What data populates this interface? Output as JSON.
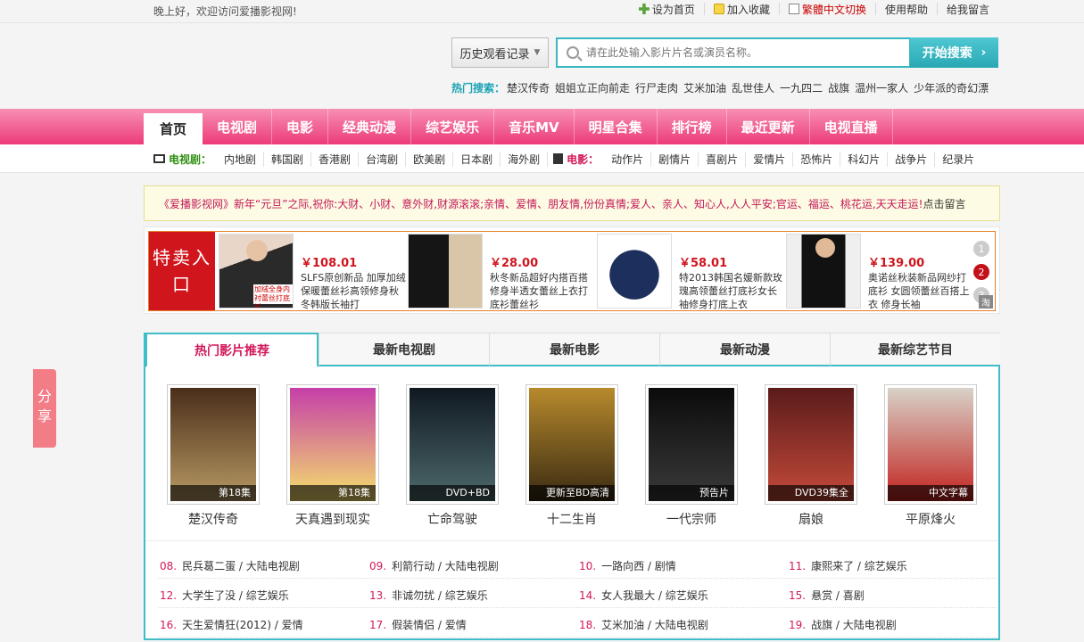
{
  "topbar": {
    "greeting": "晚上好，欢迎访问爱播影视网!",
    "links": [
      "设为首页",
      "加入收藏",
      "繁體中文切换",
      "使用帮助",
      "给我留言"
    ]
  },
  "header": {
    "history_label": "历史观看记录",
    "search_placeholder": "请在此处输入影片片名或演员名称。",
    "search_button": "开始搜索",
    "hot_label": "热门搜索：",
    "hot_terms": [
      "楚汉传奇",
      "姐姐立正向前走",
      "行尸走肉",
      "艾米加油",
      "乱世佳人",
      "一九四二",
      "战旗",
      "温州一家人",
      "少年派的奇幻漂"
    ]
  },
  "nav": [
    "首页",
    "电视剧",
    "电影",
    "经典动漫",
    "综艺娱乐",
    "音乐MV",
    "明星合集",
    "排行榜",
    "最近更新",
    "电视直播"
  ],
  "subnav": {
    "tv_label": "电视剧：",
    "tv": [
      "内地剧",
      "韩国剧",
      "香港剧",
      "台湾剧",
      "欧美剧",
      "日本剧",
      "海外剧"
    ],
    "film_label": "电影：",
    "film": [
      "动作片",
      "剧情片",
      "喜剧片",
      "爱情片",
      "恐怖片",
      "科幻片",
      "战争片",
      "纪录片"
    ]
  },
  "notice": {
    "text": "《爱播影视网》新年“元旦”之际,祝你:大财、小财、意外财,财源滚滚;亲情、爱情、朋友情,份份真情;爱人、亲人、知心人,人人平安;官运、福运、桃花运,天天走运!",
    "tail": "点击留言"
  },
  "sale": {
    "entry": "特卖入口",
    "products": [
      {
        "price": "￥108.01",
        "desc": "SLFS原创新品 加厚加绒保暖蕾丝衫高领修身秋冬韩版长袖打",
        "tag": "加绒全身内衬蕾丝打底衫",
        "colors": [
          "#2a2a2a",
          "#e8d7c9"
        ]
      },
      {
        "price": "￥28.00",
        "desc": "秋冬新品超好内搭百搭修身半透女蕾丝上衣打底衫蕾丝衫",
        "colors": [
          "#151515",
          "#d9c6a8"
        ]
      },
      {
        "price": "￥58.01",
        "desc": "特2013韩国名媛新款玫瑰高领蕾丝打底衫女长袖修身打底上衣",
        "colors": [
          "#1d2f5c",
          "#ffffff"
        ]
      },
      {
        "price": "￥139.00",
        "desc": "奥诺丝秋装新品网纱打底衫 女圆领蕾丝百搭上衣 修身长袖",
        "colors": [
          "#111111",
          "#efefef"
        ]
      }
    ],
    "dots": [
      "1",
      "2",
      "3"
    ],
    "tao": "淘"
  },
  "share": "分享",
  "tabs": [
    "热门影片推荐",
    "最新电视剧",
    "最新电影",
    "最新动漫",
    "最新综艺节目"
  ],
  "movies": [
    {
      "name": "楚汉传奇",
      "badge": "第18集",
      "c1": "#4a2e1a",
      "c2": "#b89a63"
    },
    {
      "name": "天真遇到现实",
      "badge": "第18集",
      "c1": "#c53fa8",
      "c2": "#f5e06c"
    },
    {
      "name": "亡命驾驶",
      "badge": "DVD+BD",
      "c1": "#101820",
      "c2": "#4d6a6d"
    },
    {
      "name": "十二生肖",
      "badge": "更新至BD高清",
      "c1": "#3a2a12",
      "c2": "#b78a2c"
    },
    {
      "name": "一代宗师",
      "badge": "预告片",
      "c1": "#0b0b0b",
      "c2": "#3a3a3a"
    },
    {
      "name": "扇娘",
      "badge": "DVD39集全",
      "c1": "#5b1b1b",
      "c2": "#c44a3a"
    },
    {
      "name": "平原烽火",
      "badge": "中文字幕",
      "c1": "#d8d2c8",
      "c2": "#c2231f"
    }
  ],
  "list": [
    [
      {
        "no": "08.",
        "t": "民兵葛二蛋 / 大陆电视剧"
      },
      {
        "no": "09.",
        "t": "利箭行动 / 大陆电视剧"
      },
      {
        "no": "10.",
        "t": "一路向西 / 剧情"
      },
      {
        "no": "11.",
        "t": "康熙来了 / 综艺娱乐"
      }
    ],
    [
      {
        "no": "12.",
        "t": "大学生了没 / 综艺娱乐"
      },
      {
        "no": "13.",
        "t": "非诚勿扰 / 综艺娱乐"
      },
      {
        "no": "14.",
        "t": "女人我最大 / 综艺娱乐"
      },
      {
        "no": "15.",
        "t": "悬赏 / 喜剧"
      }
    ],
    [
      {
        "no": "16.",
        "t": "天生爱情狂(2012) / 爱情"
      },
      {
        "no": "17.",
        "t": "假装情侣 / 爱情"
      },
      {
        "no": "18.",
        "t": "艾米加油 / 大陆电视剧"
      },
      {
        "no": "19.",
        "t": "战旗 / 大陆电视剧"
      }
    ]
  ]
}
